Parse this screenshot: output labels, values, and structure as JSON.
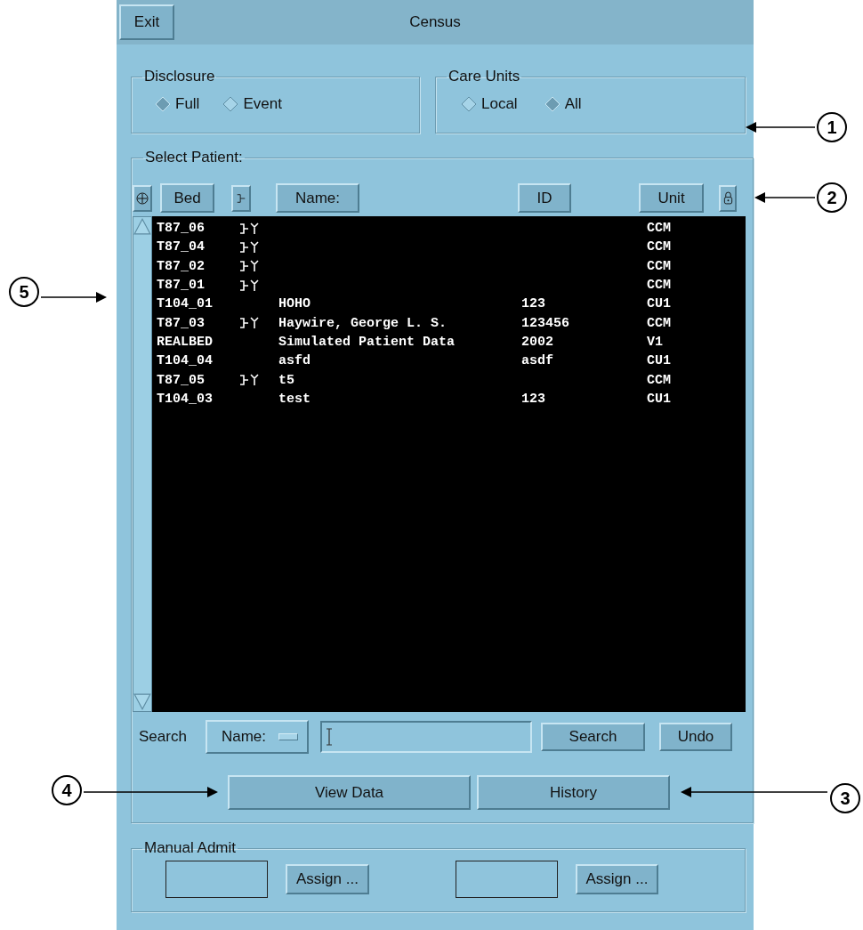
{
  "window": {
    "title": "Census",
    "exit_button": "Exit"
  },
  "disclosure": {
    "label": "Disclosure",
    "options": [
      {
        "label": "Full",
        "selected": true
      },
      {
        "label": "Event",
        "selected": false
      }
    ]
  },
  "care_units": {
    "label": "Care Units",
    "options": [
      {
        "label": "Local",
        "selected": false
      },
      {
        "label": "All",
        "selected": true
      }
    ]
  },
  "select_patient": {
    "label": "Select Patient:",
    "columns": [
      "Bed",
      "Name:",
      "ID",
      "Unit"
    ],
    "rows": [
      {
        "bed": "T87_06",
        "monitored": true,
        "name": "",
        "id": "",
        "unit": "CCM"
      },
      {
        "bed": "T87_04",
        "monitored": true,
        "name": "",
        "id": "",
        "unit": "CCM"
      },
      {
        "bed": "T87_02",
        "monitored": true,
        "name": "",
        "id": "",
        "unit": "CCM"
      },
      {
        "bed": "T87_01",
        "monitored": true,
        "name": "",
        "id": "",
        "unit": "CCM"
      },
      {
        "bed": "T104_01",
        "monitored": false,
        "name": "HOHO",
        "id": "123",
        "unit": "CU1"
      },
      {
        "bed": "T87_03",
        "monitored": true,
        "name": "Haywire, George L. S.",
        "id": "123456",
        "unit": "CCM"
      },
      {
        "bed": "REALBED",
        "monitored": false,
        "name": "Simulated Patient Data",
        "id": "2002",
        "unit": "V1"
      },
      {
        "bed": "T104_04",
        "monitored": false,
        "name": "asfd",
        "id": "asdf",
        "unit": "CU1"
      },
      {
        "bed": "T87_05",
        "monitored": true,
        "name": "t5",
        "id": "",
        "unit": "CCM"
      },
      {
        "bed": "T104_03",
        "monitored": false,
        "name": "test",
        "id": "123",
        "unit": "CU1"
      }
    ],
    "search": {
      "label": "Search",
      "field_menu": "Name:",
      "search_button": "Search",
      "undo_button": "Undo"
    },
    "actions": [
      "View Data",
      "History"
    ]
  },
  "manual_admit": {
    "label": "Manual Admit",
    "slots": [
      {
        "button": "Assign ..."
      },
      {
        "button": "Assign ..."
      }
    ]
  },
  "callouts": [
    {
      "number": "1"
    },
    {
      "number": "2"
    },
    {
      "number": "3"
    },
    {
      "number": "4"
    },
    {
      "number": "5"
    }
  ]
}
